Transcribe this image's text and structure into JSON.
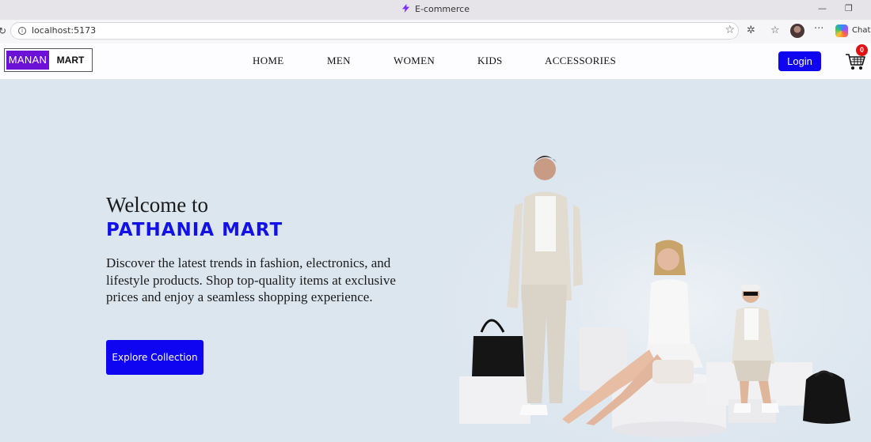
{
  "browser": {
    "tab_title": "E-commerce",
    "url": "localhost:5173",
    "chat_label": "Chat",
    "icons": [
      "bolt-favicon",
      "reload-icon",
      "info-icon",
      "star-icon",
      "extensions-icon",
      "favorites-icon",
      "profile-avatar",
      "more-icon",
      "copilot-icon"
    ]
  },
  "navbar": {
    "logo_left": "MANAN",
    "logo_right": "MART",
    "links": [
      "HOME",
      "MEN",
      "WOMEN",
      "KIDS",
      "ACCESSORIES"
    ],
    "login_label": "Login",
    "cart_count": "0"
  },
  "hero": {
    "title_line1": "Welcome to",
    "title_line2": "PATHANIA MART",
    "description": "Discover the latest trends in fashion, electronics, and lifestyle products. Shop top-quality items at exclusive prices and enjoy a seamless shopping experience.",
    "cta_label": "Explore Collection"
  },
  "colors": {
    "accent": "#1005f0",
    "logo_purple": "#6b12d6",
    "hero_bg": "#dce6ef",
    "badge_red": "#e01010"
  }
}
